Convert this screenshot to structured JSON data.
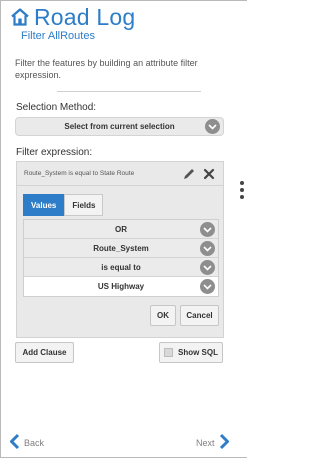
{
  "header": {
    "title": "Road Log",
    "subtitle": "Filter AllRoutes"
  },
  "description": "Filter the features by building an attribute filter expression.",
  "selection_method": {
    "label": "Selection Method:",
    "value": "Select from current selection"
  },
  "filter_expression": {
    "label": "Filter expression:",
    "clause_title": "Route_System is equal to State Route",
    "tabs": [
      "Values",
      "Fields"
    ],
    "active_tab": "Values",
    "rows": [
      "OR",
      "Route_System",
      "is equal to",
      "US Highway"
    ],
    "ok_label": "OK",
    "cancel_label": "Cancel"
  },
  "actions": {
    "add_clause_label": "Add Clause",
    "show_sql_label": "Show SQL",
    "show_sql_checked": false
  },
  "footer": {
    "back_label": "Back",
    "next_label": "Next"
  },
  "colors": {
    "accent": "#2d7dc8",
    "chevron": "#8e8e8e"
  },
  "icons": [
    "home-icon",
    "chevron-down-icon",
    "pencil-icon",
    "close-icon",
    "chevron-left-icon",
    "chevron-right-icon",
    "more-vertical-icon"
  ]
}
